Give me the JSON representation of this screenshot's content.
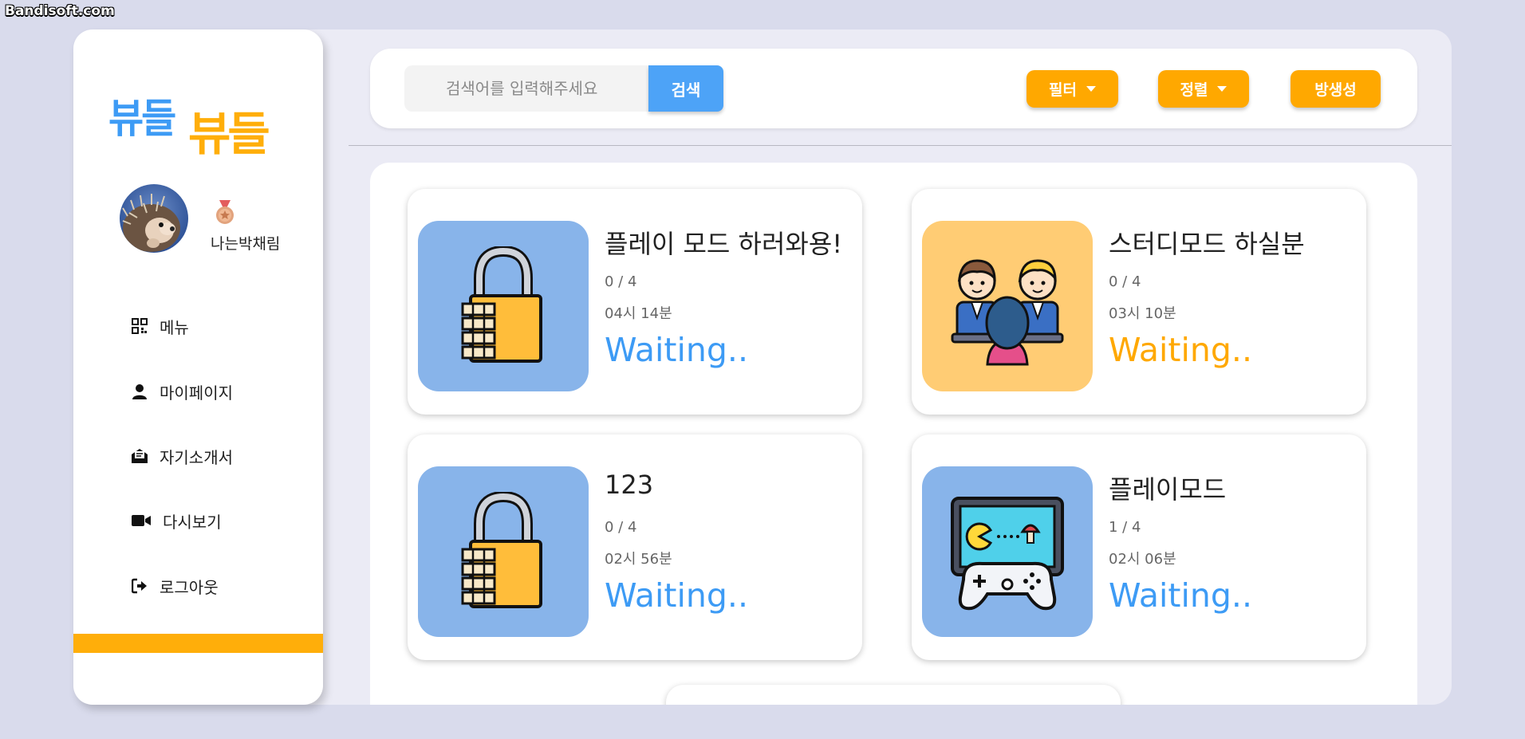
{
  "watermark": "Bandisoft.com",
  "logo": {
    "part1": "뷰들",
    "part2": "뷰들"
  },
  "profile": {
    "username": "나는박채림"
  },
  "nav": [
    {
      "label": "메뉴",
      "icon": "qr-code-icon"
    },
    {
      "label": "마이페이지",
      "icon": "user-icon"
    },
    {
      "label": "자기소개서",
      "icon": "envelope-open-icon"
    },
    {
      "label": "다시보기",
      "icon": "video-camera-icon"
    },
    {
      "label": "로그아웃",
      "icon": "sign-out-icon"
    }
  ],
  "search": {
    "placeholder": "검색어를 입력해주세요",
    "button_label": "검색"
  },
  "toolbar": {
    "filter_label": "필터",
    "sort_label": "정렬",
    "create_room_label": "방생성"
  },
  "rooms": [
    {
      "title": "플레이 모드 하러와용!",
      "count": "0 / 4",
      "time": "04시 14분",
      "status": "Waiting..",
      "thumb": "lock-icon",
      "status_color": "#3d9bf5"
    },
    {
      "title": "스터디모드 하실분",
      "count": "0 / 4",
      "time": "03시 10분",
      "status": "Waiting..",
      "thumb": "study-group-icon",
      "status_color": "#ffa800"
    },
    {
      "title": "123",
      "count": "0 / 4",
      "time": "02시 56분",
      "status": "Waiting..",
      "thumb": "lock-icon",
      "status_color": "#3d9bf5"
    },
    {
      "title": "플레이모드",
      "count": "1 / 4",
      "time": "02시 06분",
      "status": "Waiting..",
      "thumb": "game-console-icon",
      "status_color": "#3d9bf5"
    }
  ],
  "colors": {
    "accent_blue": "#4da3f7",
    "accent_orange": "#ffa800",
    "thumb_blue": "#88b4ea",
    "thumb_orange": "#ffcc74"
  }
}
